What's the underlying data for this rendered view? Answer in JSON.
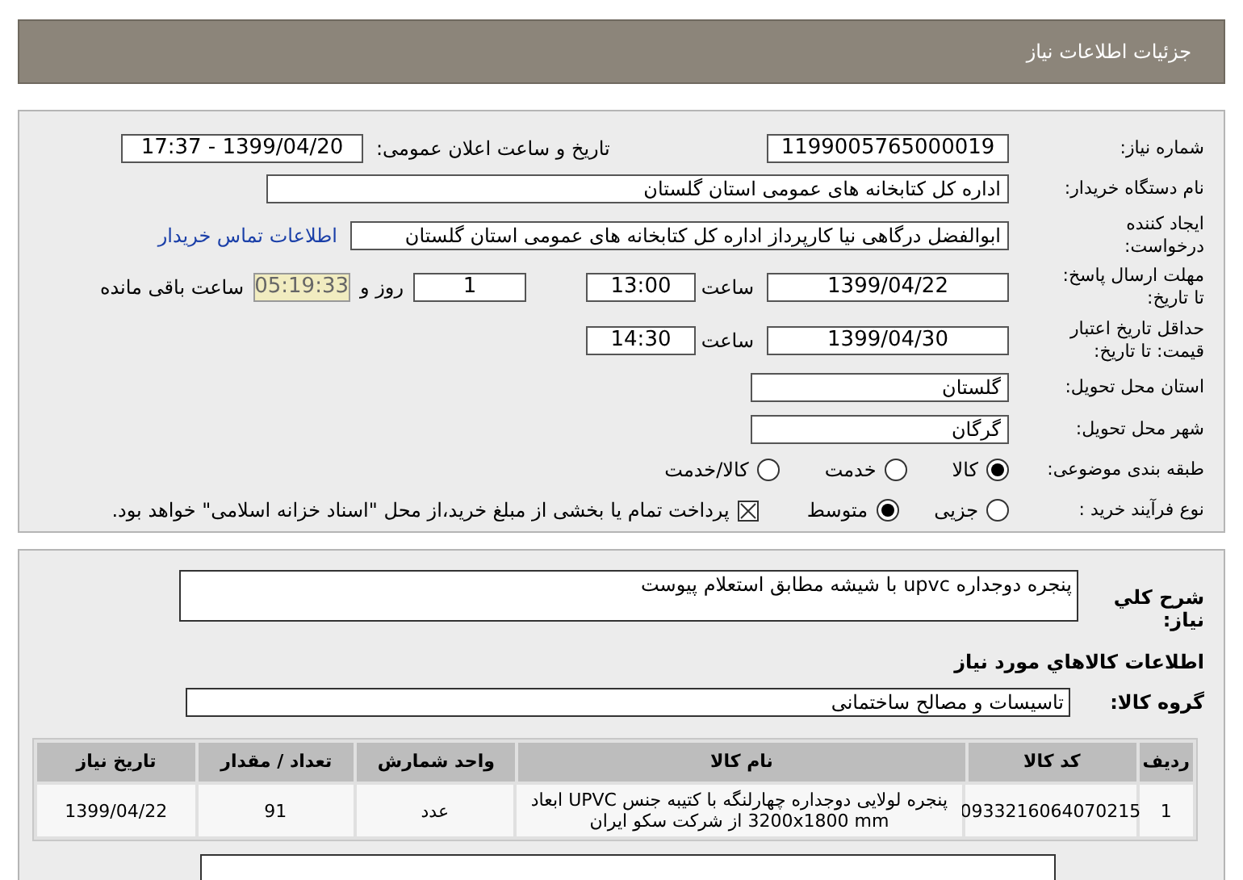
{
  "header": {
    "title": "جزئیات اطلاعات نیاز"
  },
  "need_number": {
    "label": "شماره نیاز:",
    "value": "1199005765000019"
  },
  "announce": {
    "label": "تاریخ و ساعت اعلان عمومی:",
    "value": "1399/04/20 - 17:37"
  },
  "buyer_org": {
    "label": "نام دستگاه خریدار:",
    "value": "اداره کل کتابخانه های عمومی استان گلستان"
  },
  "requester": {
    "label": "ایجاد کننده درخواست:",
    "value": "ابوالفضل  درگاهی نیا کارپرداز اداره کل کتابخانه های عمومی استان گلستان",
    "contact_link": "اطلاعات تماس خریدار"
  },
  "deadline": {
    "label": "مهلت ارسال پاسخ: تا تاریخ:",
    "date": "1399/04/22",
    "time_label": "ساعت",
    "time": "13:00",
    "days": "1",
    "days_label": "روز و",
    "remaining": "05:19:33",
    "remaining_label": "ساعت باقی مانده"
  },
  "price_validity": {
    "label": "حداقل تاریخ اعتبار قیمت: تا تاریخ:",
    "date": "1399/04/30",
    "time_label": "ساعت",
    "time": "14:30"
  },
  "province": {
    "label": "استان محل تحویل:",
    "value": "گلستان"
  },
  "city": {
    "label": "شهر محل تحویل:",
    "value": "گرگان"
  },
  "category": {
    "label": "طبقه بندی موضوعی:",
    "options": [
      {
        "label": "کالا",
        "selected": true
      },
      {
        "label": "خدمت",
        "selected": false
      },
      {
        "label": "کالا/خدمت",
        "selected": false
      }
    ]
  },
  "process": {
    "label": "نوع فرآیند خرید :",
    "options": [
      {
        "label": "جزیی",
        "selected": false
      },
      {
        "label": "متوسط",
        "selected": true
      }
    ],
    "treasury": {
      "checked": true,
      "text": "پرداخت تمام یا بخشی از مبلغ خرید،از محل \"اسناد خزانه اسلامی\" خواهد بود."
    }
  },
  "description": {
    "label": "شرح کلي نياز:",
    "value": "پنجره دوجداره upvc  با شیشه مطابق استعلام پیوست"
  },
  "goods_title": "اطلاعات کالاهاي مورد نياز",
  "goods_group": {
    "label": "گروه کالا:",
    "value": "تاسیسات و مصالح ساختمانی"
  },
  "table": {
    "columns": [
      "ردیف",
      "کد کالا",
      "نام کالا",
      "واحد شمارش",
      "تعداد / مقدار",
      "تاریخ نیاز"
    ],
    "rows": [
      [
        "1",
        "0933216064070215",
        "پنجره لولایی دوجداره چهارلنگه با کتیبه جنس UPVC ابعاد 3200x1800 mm از شرکت سکو ایران",
        "عدد",
        "91",
        "1399/04/22"
      ]
    ]
  }
}
